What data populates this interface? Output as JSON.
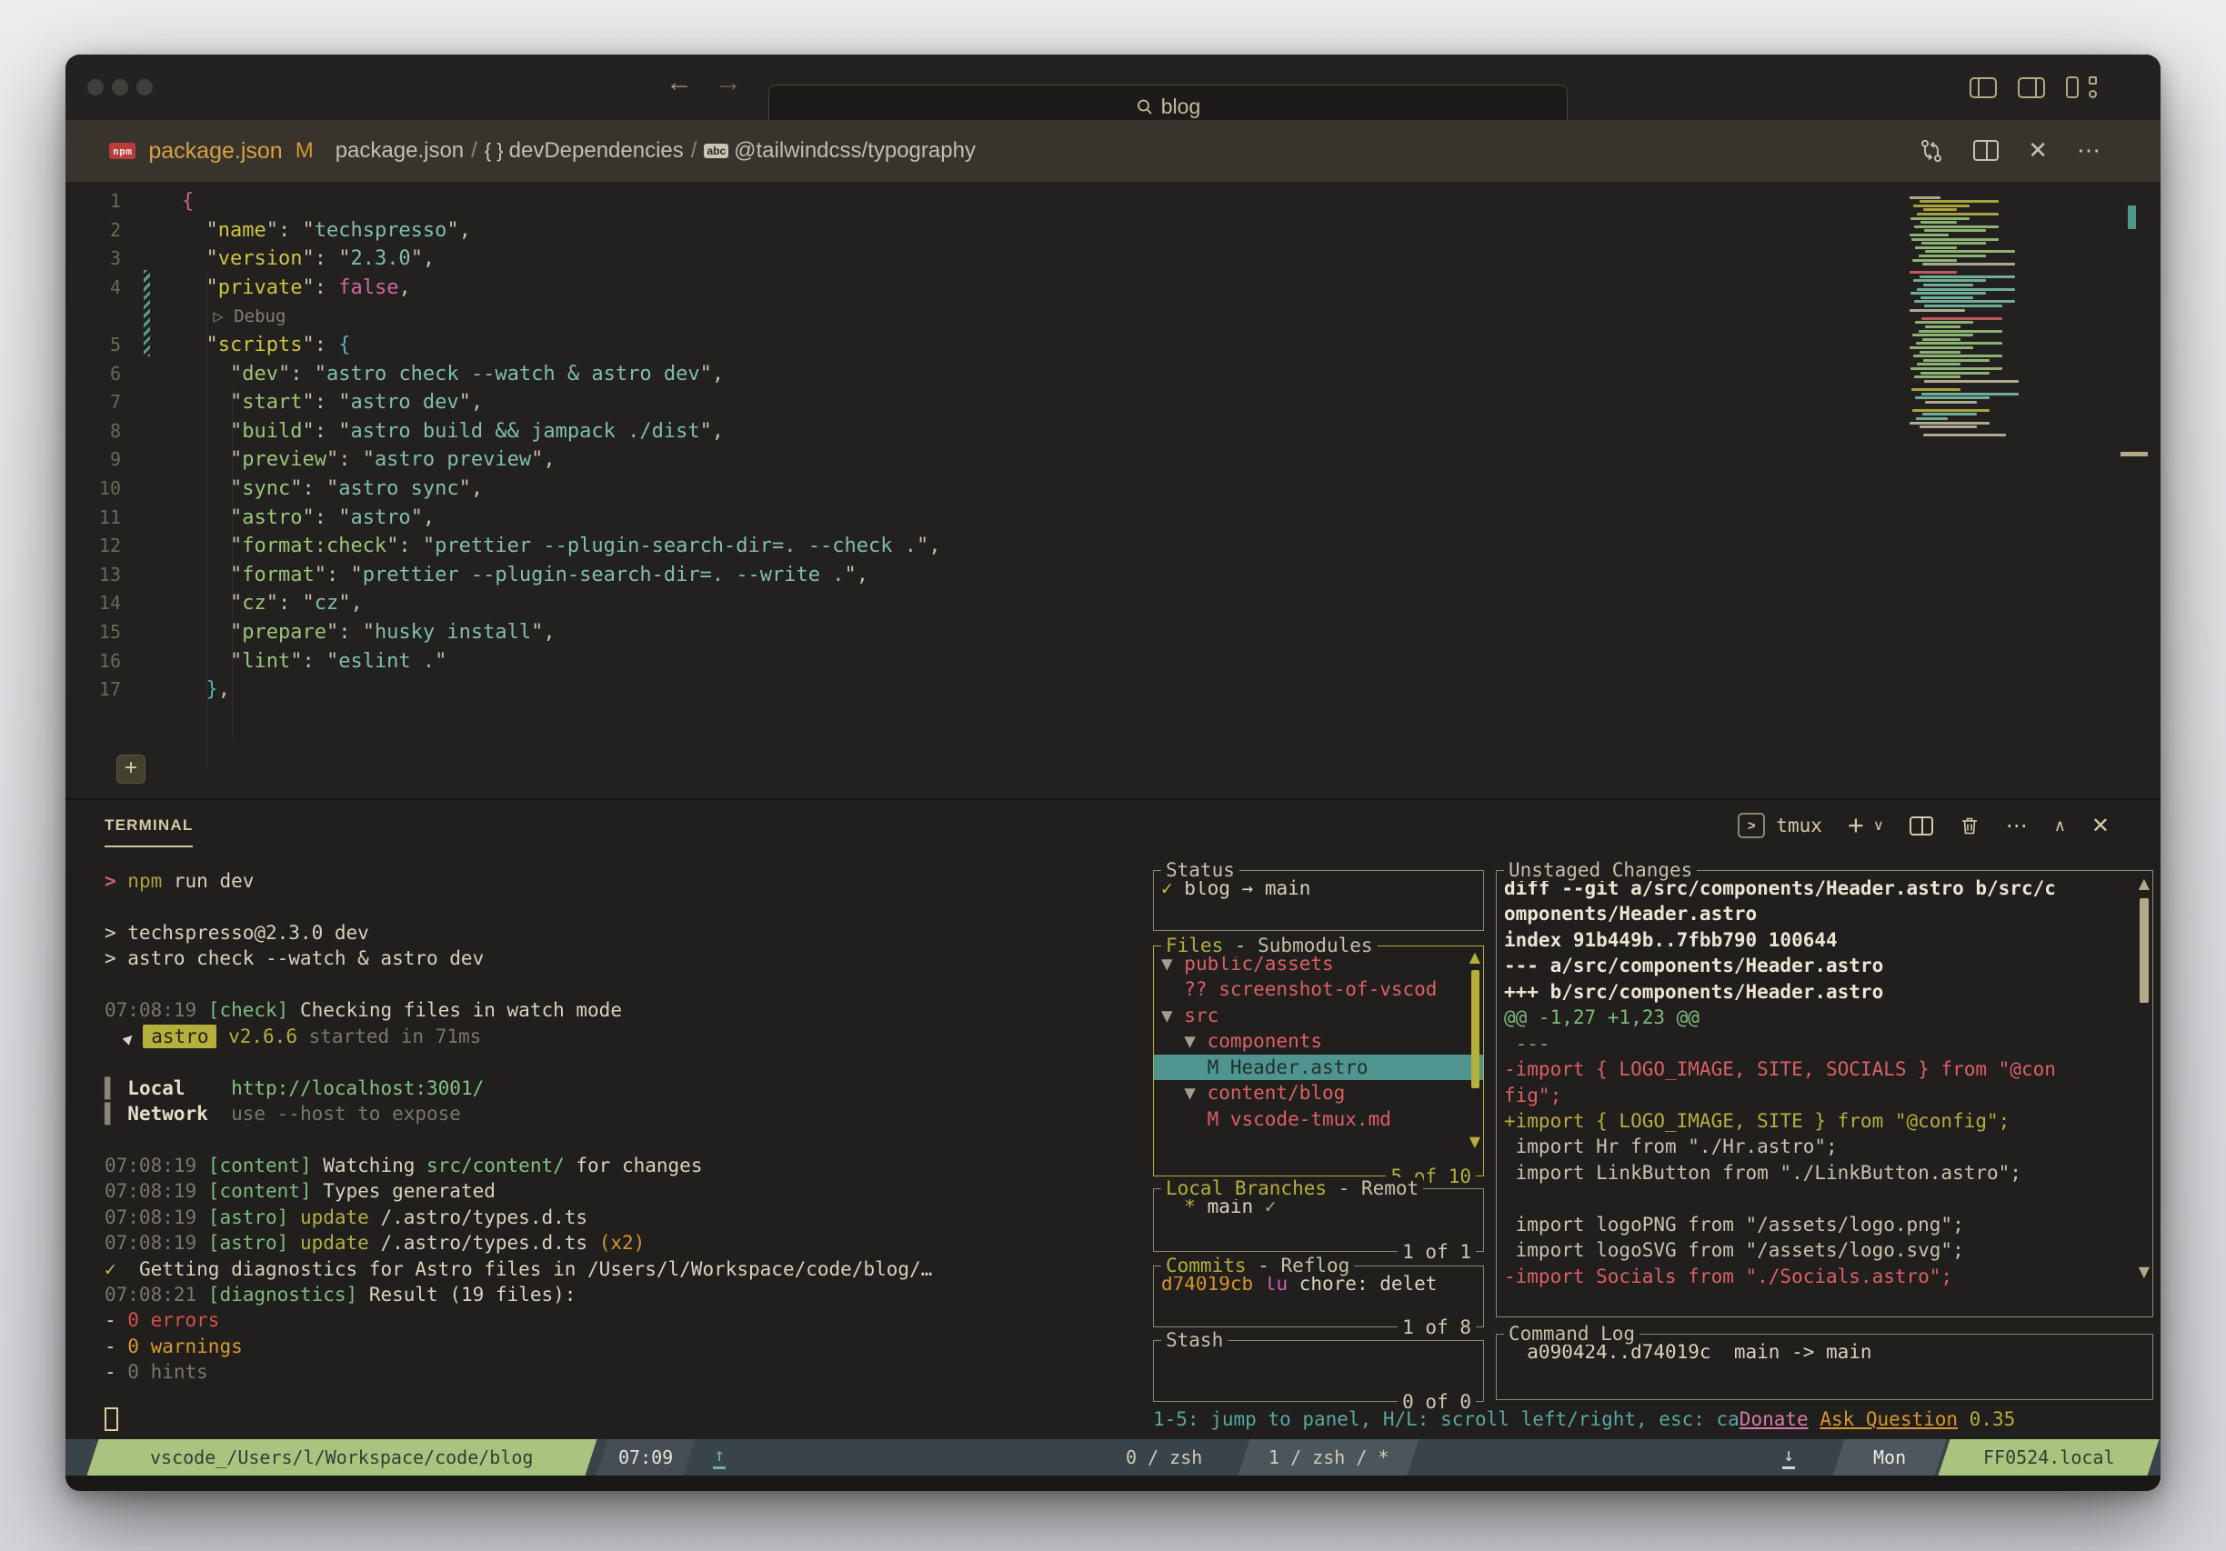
{
  "titlebar": {
    "search_value": "blog",
    "back": "←",
    "forward": "→"
  },
  "tabbar": {
    "npm_badge": "npm",
    "tab_label": "package.json",
    "modified_badge": "M",
    "crumb1": "package.json",
    "sep1": "/",
    "braces": "{ }",
    "crumb2": "devDependencies",
    "sep2": "/",
    "abc": "abc",
    "crumb3": "@tailwindcss/typography",
    "close": "✕",
    "more": "⋯"
  },
  "editor": {
    "lines": [
      {
        "n": "1",
        "t": [
          [
            "pink",
            "{"
          ]
        ]
      },
      {
        "n": "2",
        "t": [
          [
            "tan",
            "  \""
          ],
          [
            "ykey",
            "name"
          ],
          [
            "tan",
            "\": \""
          ],
          [
            "str",
            "techspresso"
          ],
          [
            "tan",
            "\","
          ]
        ]
      },
      {
        "n": "3",
        "t": [
          [
            "tan",
            "  \""
          ],
          [
            "ykey",
            "version"
          ],
          [
            "tan",
            "\": \""
          ],
          [
            "str",
            "2.3.0"
          ],
          [
            "tan",
            "\","
          ]
        ]
      },
      {
        "n": "4",
        "t": [
          [
            "tan",
            "  \""
          ],
          [
            "ykey",
            "private"
          ],
          [
            "tan",
            "\": "
          ],
          [
            "pinkv",
            "false"
          ],
          [
            "tan",
            ","
          ]
        ]
      },
      {
        "n": "",
        "t": [
          [
            "lens",
            "   ▷ Debug"
          ]
        ]
      },
      {
        "n": "5",
        "t": [
          [
            "tan",
            "  \""
          ],
          [
            "ykey",
            "scripts"
          ],
          [
            "tan",
            "\": "
          ],
          [
            "cyan",
            "{"
          ]
        ]
      },
      {
        "n": "6",
        "t": [
          [
            "tan",
            "    \""
          ],
          [
            "gkey",
            "dev"
          ],
          [
            "tan",
            "\": \""
          ],
          [
            "str",
            "astro check --watch & astro dev"
          ],
          [
            "tan",
            "\","
          ]
        ]
      },
      {
        "n": "7",
        "t": [
          [
            "tan",
            "    \""
          ],
          [
            "gkey",
            "start"
          ],
          [
            "tan",
            "\": \""
          ],
          [
            "str",
            "astro dev"
          ],
          [
            "tan",
            "\","
          ]
        ]
      },
      {
        "n": "8",
        "t": [
          [
            "tan",
            "    \""
          ],
          [
            "gkey",
            "build"
          ],
          [
            "tan",
            "\": \""
          ],
          [
            "str",
            "astro build && jampack ./dist"
          ],
          [
            "tan",
            "\","
          ]
        ]
      },
      {
        "n": "9",
        "t": [
          [
            "tan",
            "    \""
          ],
          [
            "gkey",
            "preview"
          ],
          [
            "tan",
            "\": \""
          ],
          [
            "str",
            "astro preview"
          ],
          [
            "tan",
            "\","
          ]
        ]
      },
      {
        "n": "10",
        "t": [
          [
            "tan",
            "    \""
          ],
          [
            "gkey",
            "sync"
          ],
          [
            "tan",
            "\": \""
          ],
          [
            "str",
            "astro sync"
          ],
          [
            "tan",
            "\","
          ]
        ]
      },
      {
        "n": "11",
        "t": [
          [
            "tan",
            "    \""
          ],
          [
            "gkey",
            "astro"
          ],
          [
            "tan",
            "\": \""
          ],
          [
            "str",
            "astro"
          ],
          [
            "tan",
            "\","
          ]
        ]
      },
      {
        "n": "12",
        "t": [
          [
            "tan",
            "    \""
          ],
          [
            "gkey",
            "format:check"
          ],
          [
            "tan",
            "\": \""
          ],
          [
            "str",
            "prettier --plugin-search-dir=. --check ."
          ],
          [
            "tan",
            "\","
          ]
        ]
      },
      {
        "n": "13",
        "t": [
          [
            "tan",
            "    \""
          ],
          [
            "gkey",
            "format"
          ],
          [
            "tan",
            "\": \""
          ],
          [
            "str",
            "prettier --plugin-search-dir=. --write ."
          ],
          [
            "tan",
            "\","
          ]
        ]
      },
      {
        "n": "14",
        "t": [
          [
            "tan",
            "    \""
          ],
          [
            "gkey",
            "cz"
          ],
          [
            "tan",
            "\": \""
          ],
          [
            "str",
            "cz"
          ],
          [
            "tan",
            "\","
          ]
        ]
      },
      {
        "n": "15",
        "t": [
          [
            "tan",
            "    \""
          ],
          [
            "gkey",
            "prepare"
          ],
          [
            "tan",
            "\": \""
          ],
          [
            "str",
            "husky install"
          ],
          [
            "tan",
            "\","
          ]
        ]
      },
      {
        "n": "16",
        "t": [
          [
            "tan",
            "    \""
          ],
          [
            "gkey",
            "lint"
          ],
          [
            "tan",
            "\": \""
          ],
          [
            "str",
            "eslint ."
          ],
          [
            "tan",
            "\""
          ]
        ]
      },
      {
        "n": "17",
        "t": [
          [
            "cyan",
            "  }"
          ],
          [
            "tan",
            ","
          ]
        ]
      }
    ]
  },
  "terminal_header": {
    "title": "TERMINAL",
    "shell_label": "tmux"
  },
  "terminal": {
    "lines": [
      [
        [
          "prompt",
          "> "
        ],
        [
          "npm",
          "npm"
        ],
        [
          "cream",
          " run dev"
        ]
      ],
      [],
      [
        [
          "cream",
          "> techspresso@2.3.0 dev"
        ]
      ],
      [
        [
          "cream",
          "> astro check --watch & astro dev"
        ]
      ],
      [],
      [
        [
          "dim",
          "07:08:19 "
        ],
        [
          "green",
          "[check]"
        ],
        [
          "cream",
          " Checking files in watch mode"
        ]
      ],
      [
        [
          "rocket",
          "▲"
        ],
        [
          "badge",
          "astro"
        ],
        [
          "olive",
          " v2.6.6"
        ],
        [
          "dim",
          " started in 71ms"
        ]
      ],
      [],
      [
        [
          "bar",
          "▌ "
        ],
        [
          "creamb",
          "Local    "
        ],
        [
          "url",
          "http://localhost:3001/"
        ]
      ],
      [
        [
          "bar",
          "▌ "
        ],
        [
          "creamb",
          "Network  "
        ],
        [
          "dim",
          "use --host to expose"
        ]
      ],
      [],
      [
        [
          "dim",
          "07:08:19 "
        ],
        [
          "green",
          "[content]"
        ],
        [
          "cream",
          " Watching "
        ],
        [
          "url",
          "src/content/"
        ],
        [
          "cream",
          " for changes"
        ]
      ],
      [
        [
          "dim",
          "07:08:19 "
        ],
        [
          "green",
          "[content]"
        ],
        [
          "cream",
          " Types generated"
        ]
      ],
      [
        [
          "dim",
          "07:08:19 "
        ],
        [
          "green",
          "[astro]"
        ],
        [
          "olive",
          " update "
        ],
        [
          "cream",
          "/.astro/types.d.ts"
        ]
      ],
      [
        [
          "dim",
          "07:08:19 "
        ],
        [
          "green",
          "[astro]"
        ],
        [
          "olive",
          " update "
        ],
        [
          "cream",
          "/.astro/types.d.ts "
        ],
        [
          "orange",
          "(x2)"
        ]
      ],
      [
        [
          "check",
          "✓ "
        ],
        [
          "cream",
          " Getting diagnostics for Astro files in /Users/l/Workspace/code/blog/…"
        ]
      ],
      [
        [
          "dim",
          "07:08:21 "
        ],
        [
          "green",
          "[diagnostics]"
        ],
        [
          "cream",
          " Result (19 files):"
        ]
      ],
      [
        [
          "cream",
          "- "
        ],
        [
          "red",
          "0 errors"
        ]
      ],
      [
        [
          "cream",
          "- "
        ],
        [
          "warn",
          "0 warnings"
        ]
      ],
      [
        [
          "cream",
          "- "
        ],
        [
          "dim",
          "0 hints"
        ]
      ]
    ]
  },
  "lazygit": {
    "status": {
      "title": [
        [
          "tan",
          "Status"
        ]
      ],
      "rows": [
        [
          [
            "check",
            "✓"
          ],
          [
            "cream",
            " blog "
          ],
          [
            "cream",
            "→"
          ],
          [
            "cream",
            " main"
          ]
        ]
      ]
    },
    "files": {
      "title": [
        [
          "plus",
          "Files"
        ],
        [
          "tan",
          " - Submodules"
        ]
      ],
      "rows": [
        [
          [
            "arrow",
            "▼ "
          ],
          [
            "redf",
            "public/assets"
          ]
        ],
        [
          [
            "redf",
            "  ?? screenshot-of-vscod"
          ]
        ],
        [
          [
            "arrow",
            "▼ "
          ],
          [
            "redf",
            "src"
          ]
        ],
        [
          [
            "arrow",
            "  ▼ "
          ],
          [
            "redf",
            "components"
          ]
        ],
        {
          "cls": "sel",
          "t": [
            [
              "seld",
              "    M Header.astro"
            ]
          ]
        },
        [
          [
            "arrow",
            "  ▼ "
          ],
          [
            "redf",
            "content/blog"
          ]
        ],
        [
          [
            "redf",
            "    M vscode-tmux.md"
          ]
        ]
      ],
      "count": "5 of 10"
    },
    "branches": {
      "title": [
        [
          "plus",
          "Local Branches"
        ],
        [
          "tan",
          " - Remot"
        ]
      ],
      "rows": [
        [
          [
            "plus",
            "  * "
          ],
          [
            "cream",
            "main "
          ],
          [
            "green",
            "✓"
          ]
        ]
      ],
      "count": "1 of 1"
    },
    "commits": {
      "title": [
        [
          "plus",
          "Commits"
        ],
        [
          "tan",
          " - Reflog"
        ]
      ],
      "rows": [
        [
          [
            "orange",
            "d74019cb "
          ],
          [
            "magenta",
            "lu "
          ],
          [
            "cream",
            "chore: delet"
          ]
        ]
      ],
      "count": "1 of 8"
    },
    "stash": {
      "title": [
        [
          "tan",
          "Stash"
        ]
      ],
      "rows": [],
      "count": "0 of 0"
    },
    "unstaged": {
      "title": [
        [
          "tan",
          "Unstaged Changes"
        ]
      ],
      "rows": [
        [
          [
            "w",
            "diff --git a/src/components/Header.astro b/src/c"
          ]
        ],
        [
          [
            "w",
            "omponents/Header.astro"
          ]
        ],
        [
          [
            "w",
            "index 91b449b..7fbb790 100644"
          ]
        ],
        [
          [
            "w",
            "--- a/src/components/Header.astro"
          ]
        ],
        [
          [
            "w",
            "+++ b/src/components/Header.astro"
          ]
        ],
        [
          [
            "green",
            "@@ -1,27 +1,23 @@"
          ]
        ],
        [
          [
            "dimc",
            " ---"
          ]
        ],
        [
          [
            "redf",
            "-import { LOGO_IMAGE, SITE, SOCIALS } from \"@con"
          ]
        ],
        [
          [
            "redf",
            "fig\";"
          ]
        ],
        [
          [
            "plus",
            "+import { LOGO_IMAGE, SITE } from \"@config\";"
          ]
        ],
        [
          [
            "ctx",
            " import Hr from \"./Hr.astro\";"
          ]
        ],
        [
          [
            "ctx",
            " import LinkButton from \"./LinkButton.astro\";"
          ]
        ],
        [],
        [
          [
            "ctx",
            " import logoPNG from \"/assets/logo.png\";"
          ]
        ],
        [
          [
            "ctx",
            " import logoSVG from \"/assets/logo.svg\";"
          ]
        ],
        [
          [
            "redf",
            "-import Socials from \"./Socials.astro\";"
          ]
        ]
      ]
    },
    "cmdlog": {
      "title": [
        [
          "tan",
          "Command Log"
        ]
      ],
      "rows": [
        [
          [
            "cream",
            "  a090424..d74019c  main -> main"
          ]
        ]
      ]
    },
    "help": [
      [
        "teal",
        "1-5: jump to panel, H/L: scroll left/right, esc: ca"
      ],
      [
        "pinku",
        "Donate"
      ],
      [
        "teal",
        " "
      ],
      [
        "orangeu",
        "Ask Question"
      ],
      [
        "plus",
        " 0.35"
      ]
    ]
  },
  "tmux": {
    "session": "vscode_/Users/l/Workspace/code/blog",
    "time": "07:09",
    "win0": "0 / zsh",
    "win1": "1 / zsh / *",
    "day": "Mon",
    "host": "FF0524.local"
  }
}
